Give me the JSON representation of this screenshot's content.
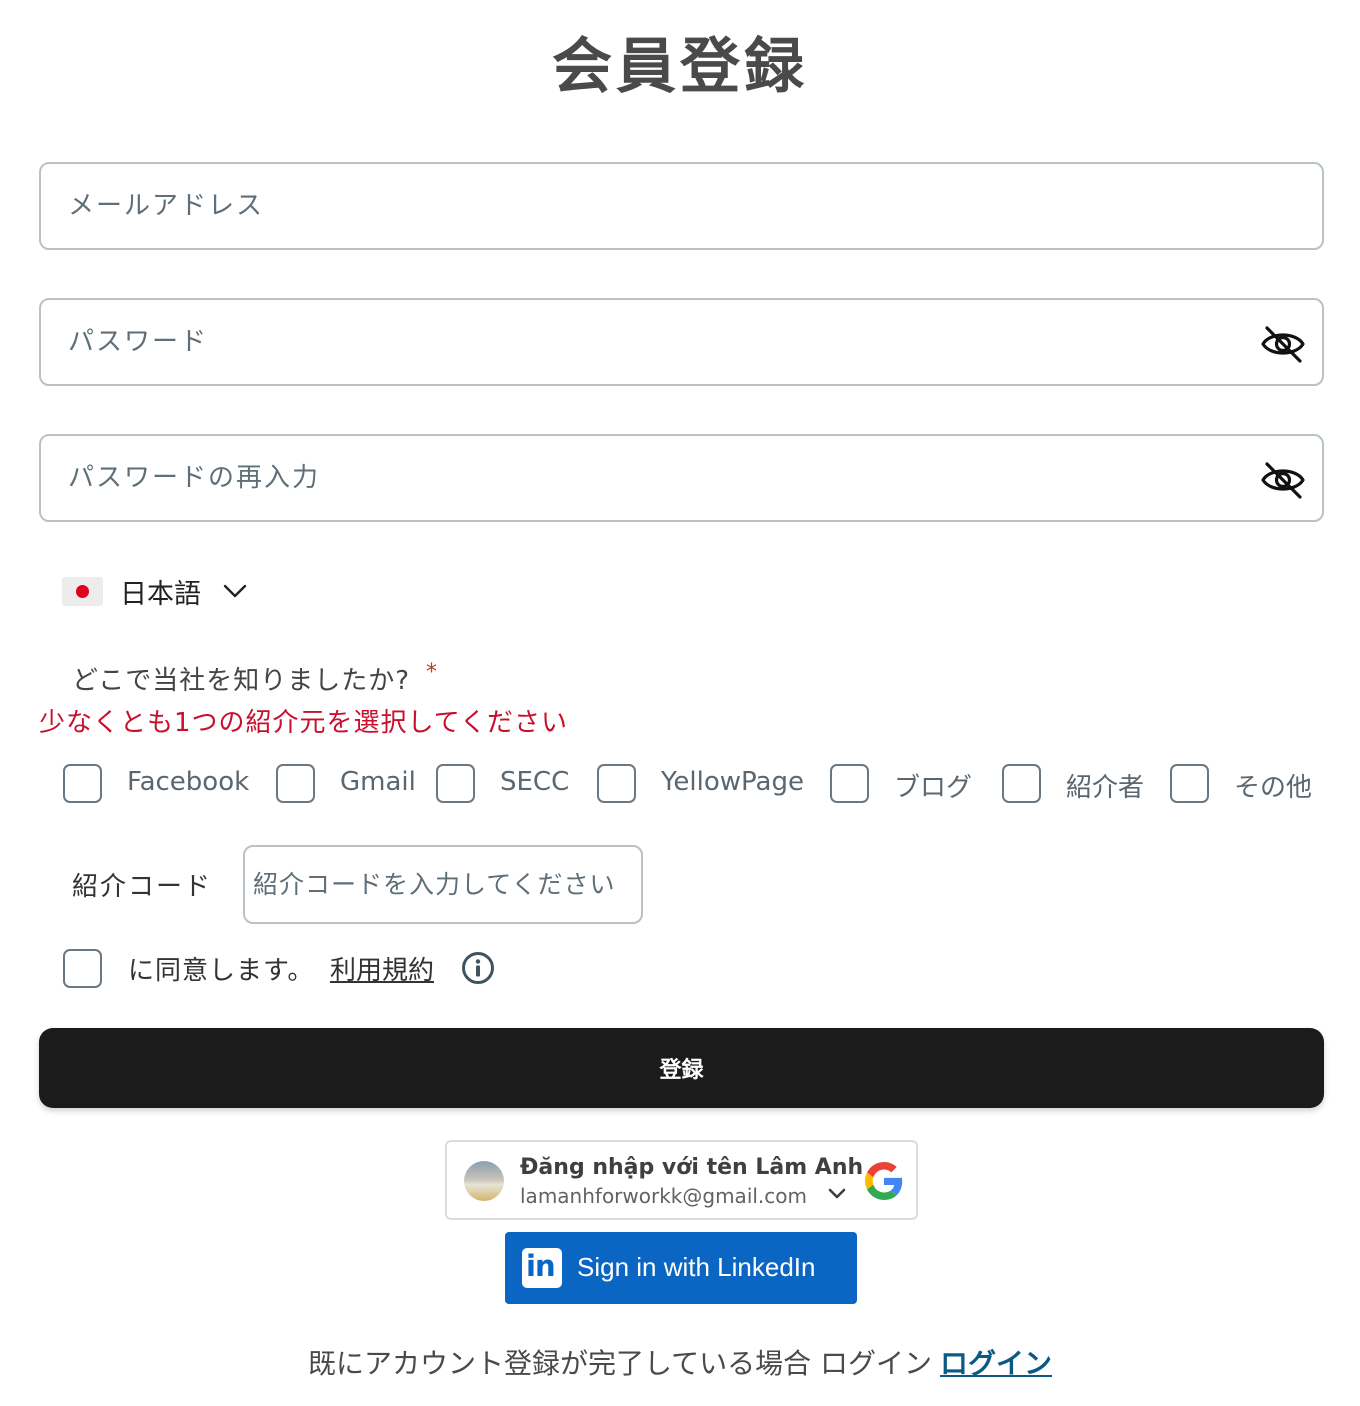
{
  "page_title": "会員登録",
  "email": {
    "placeholder": "メールアドレス",
    "value": ""
  },
  "password": {
    "placeholder": "パスワード",
    "value": "",
    "toggle_icon": "eye-off-icon"
  },
  "password_confirm": {
    "placeholder": "パスワードの再入力",
    "value": "",
    "toggle_icon": "eye-off-icon"
  },
  "language": {
    "flag": "japan-flag-icon",
    "label": "日本語"
  },
  "source_question": {
    "label": "どこで当社を知りましたか?",
    "required_mark": "*"
  },
  "source_error": "少なくとも1つの紹介元を選択してください",
  "sources": [
    {
      "label": "Facebook",
      "checked": false
    },
    {
      "label": "Gmail",
      "checked": false
    },
    {
      "label": "SECC",
      "checked": false
    },
    {
      "label": "YellowPage",
      "checked": false
    },
    {
      "label": "ブログ",
      "checked": false
    },
    {
      "label": "紹介者",
      "checked": false
    },
    {
      "label": "その他",
      "checked": false
    }
  ],
  "referral": {
    "label": "紹介コード",
    "placeholder": "紹介コードを入力してください",
    "value": ""
  },
  "agreement": {
    "text": "に同意します。",
    "terms_link": "利用規約",
    "checked": false
  },
  "submit_label": "登録",
  "google_signin": {
    "name": "Đăng nhập với tên Lâm Anh",
    "email": "lamanhforworkk@gmail.com"
  },
  "linkedin_signin": {
    "label": "Sign in with LinkedIn"
  },
  "footer": {
    "text": "既にアカウント登録が完了している場合 ログイン",
    "login_link": "ログイン"
  },
  "colors": {
    "accent": "#0a5a86",
    "error": "#c8102e",
    "submit_bg": "#1b1b1b",
    "linkedin": "#0a66c2"
  }
}
